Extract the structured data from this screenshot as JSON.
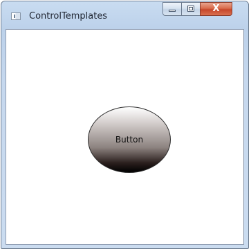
{
  "window": {
    "title": "ControlTemplates",
    "icon": "window-app-icon",
    "caption_buttons": {
      "minimize_icon": "minimize-icon",
      "maximize_icon": "maximize-icon",
      "close_glyph": "X"
    }
  },
  "content": {
    "button_label": "Button"
  },
  "colors": {
    "frame": "#bcd1ea",
    "close_button": "#d96c4c",
    "client_background": "#ffffff",
    "button_gradient_top": "#ffffff",
    "button_gradient_bottom": "#000000"
  }
}
